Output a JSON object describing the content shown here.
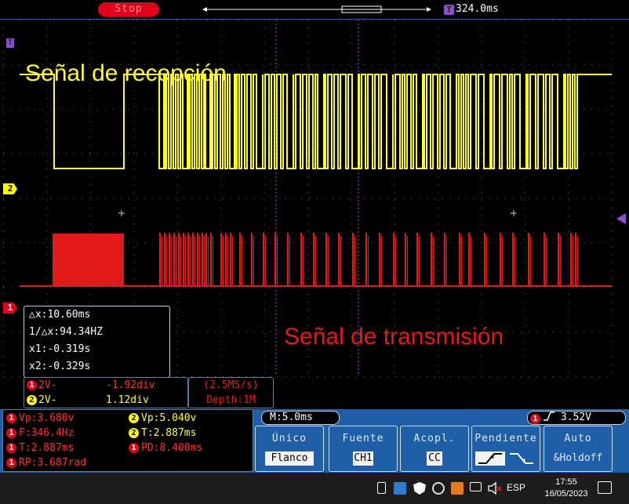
{
  "top_bar": {
    "run_state": "Stop",
    "trigger_time": "324.0ms",
    "trigger_icon": "T"
  },
  "waveforms": {
    "reception_title": "Señal de recepción",
    "transmission_title": "Señal de transmisión",
    "ch2_marker": "2",
    "ch1_marker": "1",
    "reception_color": "#ffff2a",
    "transmission_color": "#e31a1a"
  },
  "cursor": {
    "dx": "△x:10.60ms",
    "inv_dx": "1/△x:94.34HZ",
    "x1": "x1:-0.319s",
    "x2": "x2:-0.329s"
  },
  "channels": {
    "ch1": {
      "badge": "1",
      "volts": "2V-",
      "div": "-1.92div"
    },
    "ch2": {
      "badge": "2",
      "volts": "2V-",
      "div": "1.12div"
    }
  },
  "acquisition": {
    "sample_rate": "(2.5MS/s)",
    "depth": "Depth:1M"
  },
  "measurements": {
    "ch1_vp": "Vp:3.680v",
    "ch2_vp": "Vp:5.040v",
    "ch1_freq": "F:346.4Hz",
    "ch2_period": "T:2.887ms",
    "ch1_period": "T:2.887ms",
    "ch1_pd": "PD:8.400ms",
    "ch1_rp": "RP:3.687rad"
  },
  "timebase": "M:5.0ms",
  "trigger_level": "3.52V",
  "softkeys": [
    {
      "title": "Único",
      "value": "Flanco"
    },
    {
      "title": "Fuente",
      "value": "CH1"
    },
    {
      "title": "Acopl.",
      "value": "CC"
    },
    {
      "title": "Pendiente",
      "value": ""
    },
    {
      "title": "Auto",
      "value": "&Holdoff"
    }
  ],
  "taskbar": {
    "language": "ESP",
    "time": "17:55",
    "date": "16/05/2023"
  }
}
